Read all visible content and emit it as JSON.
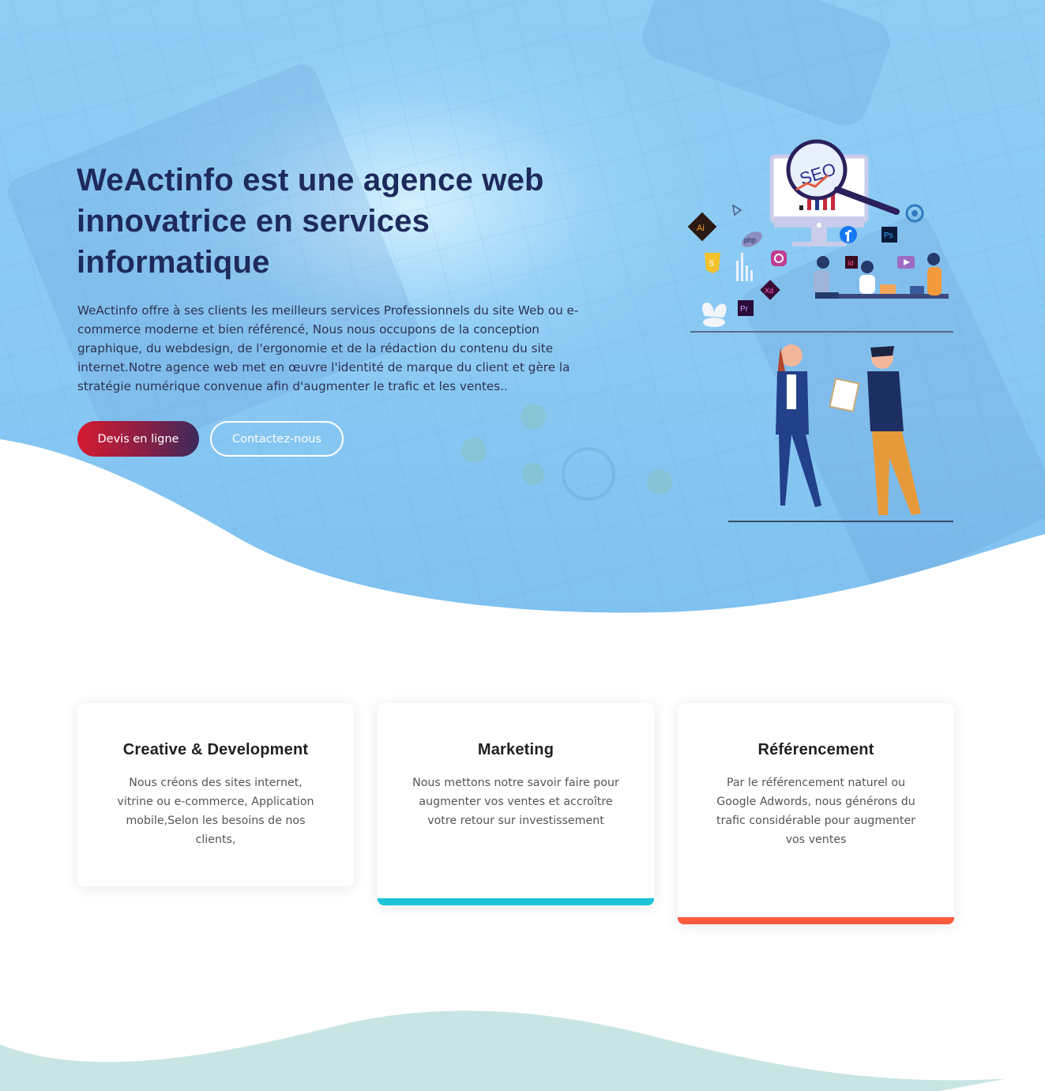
{
  "hero": {
    "title": "WeActinfo est une agence web innovatrice en services informatique",
    "description": "WeActinfo offre à ses clients les meilleurs services Professionnels du site Web ou e-commerce moderne et bien référencé, Nous nous occupons de la conception graphique, du webdesign, de l'ergonomie et de la rédaction du contenu du site internet.Notre agence web met en œuvre l'identité de marque du client et gère la stratégie numérique convenue afin d'augmenter le trafic et les ventes..",
    "primary_button": "Devis en ligne",
    "secondary_button": "Contactez-nous"
  },
  "illustration": {
    "seo_label": "SEO",
    "icons": [
      "ai-icon",
      "php-icon",
      "html5-icon",
      "instagram-icon",
      "xd-icon",
      "pr-icon",
      "id-icon",
      "ps-icon",
      "facebook-icon",
      "wordpress-icon",
      "youtube-icon"
    ],
    "icon_labels": {
      "ai": "Ai",
      "php": "php",
      "html5": "5",
      "xd": "Xd",
      "pr": "Pr",
      "id": "Id",
      "ps": "Ps"
    }
  },
  "services": [
    {
      "title": "Creative & Development",
      "text": "Nous créons des sites internet, vitrine ou e-commerce, Application mobile,Selon les besoins de nos clients,",
      "accent": ""
    },
    {
      "title": "Marketing",
      "text": "Nous mettons notre savoir faire pour augmenter vos ventes et accroître votre retour sur investissement",
      "accent": "#1ec3d8"
    },
    {
      "title": "Référencement",
      "text": "Par le référencement naturel ou Google Adwords, nous générons du trafic considérable pour augmenter vos ventes",
      "accent": "#fb5a3c"
    }
  ],
  "colors": {
    "hero_title": "#1d2a5b",
    "primary_gradient_start": "#d51a31",
    "primary_gradient_end": "#3a2a5c",
    "marketing_accent": "#1ec3d8",
    "seo_accent": "#fb5a3c",
    "bottom_wave": "#c9e4e4"
  }
}
